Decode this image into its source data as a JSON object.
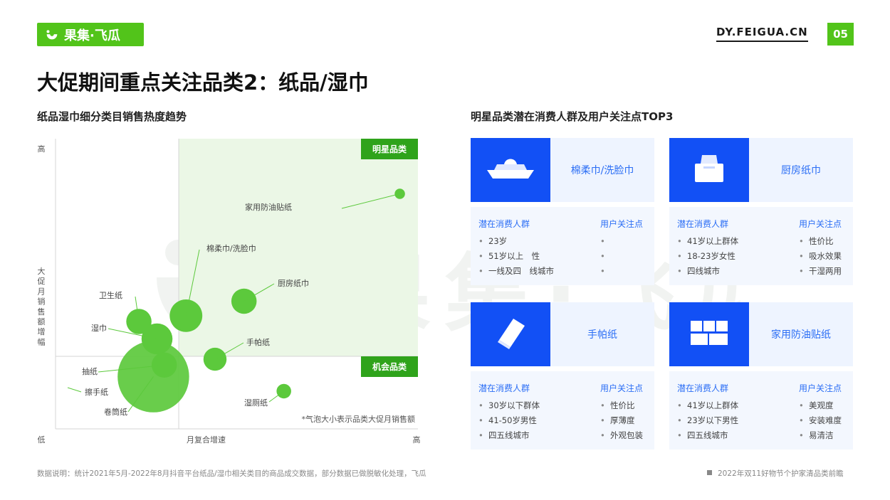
{
  "header": {
    "logo_text": "果集·飞瓜",
    "site_url": "DY.FEIGUA.CN",
    "page_number": "05"
  },
  "page_title": "大促期间重点关注品类2：纸品/湿巾",
  "left_section_title": "纸品湿巾细分类目销售热度趋势",
  "right_section_title": "明星品类潜在消费人群及用户关注点TOP3",
  "watermark_text": "果集·飞瓜",
  "colors": {
    "brand_green": "#52c41a",
    "card_blue": "#1250f5",
    "label_blue": "#2b6ef5",
    "bubble_green": "#5cc93c"
  },
  "chart_data": {
    "type": "scatter",
    "title": "纸品湿巾细分类目销售热度趋势",
    "xlabel": "月复合增速",
    "ylabel": "大促月销售额增幅",
    "x_ticks": {
      "low": "低",
      "mid": "月复合增速",
      "high": "高"
    },
    "y_ticks": {
      "high": "高",
      "mid": "大促月销售额增幅",
      "low": "低"
    },
    "xlim": [
      0,
      100
    ],
    "ylim": [
      0,
      100
    ],
    "quadrant_split": {
      "x": 34,
      "y": 25
    },
    "quadrant_labels": {
      "star": "明星品类",
      "opportunity": "机会品类"
    },
    "note": "*气泡大小表示品类大促月销售额",
    "grid": false,
    "points": [
      {
        "name": "家用防油贴纸",
        "x": 95,
        "y": 81,
        "size": 1
      },
      {
        "name": "棉柔巾/洗脸巾",
        "x": 36,
        "y": 39,
        "size": 10
      },
      {
        "name": "厨房纸巾",
        "x": 52,
        "y": 44,
        "size": 6
      },
      {
        "name": "卫生纸",
        "x": 23,
        "y": 37,
        "size": 6
      },
      {
        "name": "湿巾",
        "x": 28,
        "y": 31,
        "size": 9
      },
      {
        "name": "手帕纸",
        "x": 44,
        "y": 24,
        "size": 5
      },
      {
        "name": "抽纸",
        "x": 30,
        "y": 22,
        "size": 6
      },
      {
        "name": "卷筒纸",
        "x": 27,
        "y": 18,
        "size": 48
      },
      {
        "name": "擦手纸",
        "x": 27,
        "y": 18,
        "size": 0
      },
      {
        "name": "湿厕纸",
        "x": 63,
        "y": 13,
        "size": 2
      }
    ]
  },
  "cards": [
    {
      "category": "棉柔巾/洗脸巾",
      "icon": "tissue-box-icon",
      "audience_header": "潜在消费人群",
      "concern_header": "用户关注点",
      "audience": [
        "23岁",
        "51岁以上　性",
        "一线及四　线城市"
      ],
      "concerns": [
        "",
        "",
        ""
      ]
    },
    {
      "category": "厨房纸巾",
      "icon": "kitchen-paper-icon",
      "audience_header": "潜在消费人群",
      "concern_header": "用户关注点",
      "audience": [
        "41岁以上群体",
        "18-23岁女性",
        "四线城市"
      ],
      "concerns": [
        "性价比",
        "吸水效果",
        "干湿两用"
      ]
    },
    {
      "category": "手帕纸",
      "icon": "handkerchief-pack-icon",
      "audience_header": "潜在消费人群",
      "concern_header": "用户关注点",
      "audience": [
        "30岁以下群体",
        "41-50岁男性",
        "四五线城市"
      ],
      "concerns": [
        "性价比",
        "厚薄度",
        "外观包装"
      ]
    },
    {
      "category": "家用防油贴纸",
      "icon": "wall-sticker-icon",
      "audience_header": "潜在消费人群",
      "concern_header": "用户关注点",
      "audience": [
        "41岁以上群体",
        "23岁以下男性",
        "四五线城市"
      ],
      "concerns": [
        "美观度",
        "安装难度",
        "易清洁"
      ]
    }
  ],
  "bullet": "•",
  "footnote": "数据说明：统计2021年5月-2022年8月抖音平台纸品/湿巾相关类目的商品成交数据，部分数据已做脱敏化处理，飞瓜",
  "report_name": "2022年双11好物节个护家清品类前瞻"
}
